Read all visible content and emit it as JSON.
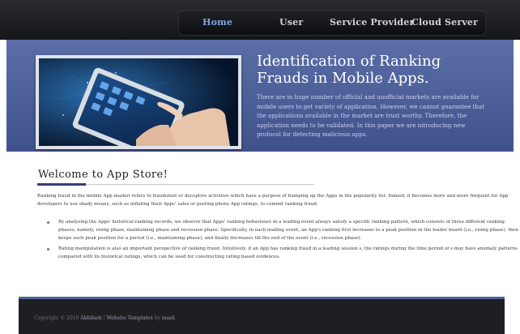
{
  "nav": {
    "items": [
      {
        "label": "Home",
        "active": true
      },
      {
        "label": "User",
        "active": false
      },
      {
        "label": "Service Provider",
        "active": false
      },
      {
        "label": "Cloud Server",
        "active": false
      }
    ]
  },
  "banner": {
    "title": "Identification of Ranking Frauds in Mobile Apps.",
    "description": "There are in huge number of official and unofficial markets are available for mobile users to get variety of application. However, we cannot guarantee that the applications available in the market are trust worthy. Therefore, the application needs to be validated. In this paper we are introducing new protocol for detecting malicious apps.",
    "image_icon": "hand-touching-tablet-icon"
  },
  "welcome": {
    "title": "Welcome to App Store!",
    "intro": "Ranking fraud in the mobile App market refers to fraudulent or deceptive activities which have a purpose of bumping up the Apps in the popularity list. Indeed, it becomes more and more frequent for App developers to use shady means, such as inflating their Apps' sales or posting phony App ratings, to commit ranking fraud.",
    "bullets": [
      "By analyzing the Apps' historical ranking records, we observe that Apps' ranking behaviours in a leading event always satisfy a specific ranking pattern, which consists of three different ranking phases, namely, rising phase, maintaining phase and recession phase. Specifically, in each leading event, an App's ranking first increases to a peak position in the leader board (i.e., rising phase), then keeps such peak position for a period (i.e., maintaining phase), and finally decreases till the end of the event (i.e., recession phase).",
      "Rating manipulation is also an important perspective of ranking fraud. Intuitively, if an App has ranking fraud in a leading session s, the ratings during the time period of s may have anomaly patterns compared with its historical ratings, which can be used for constructing rating based evidences."
    ]
  },
  "footer": {
    "copyright": "Copyright © 2016",
    "author": "Abhilash",
    "separator": " | ",
    "templates": "Website Templates",
    "by": " by ",
    "vendor": "mash"
  },
  "colors": {
    "nav_active": "#7fa6e8",
    "banner_bg": "#5b6ea6",
    "footer_bg": "#1e1f22",
    "accent": "#2f3f7a"
  }
}
